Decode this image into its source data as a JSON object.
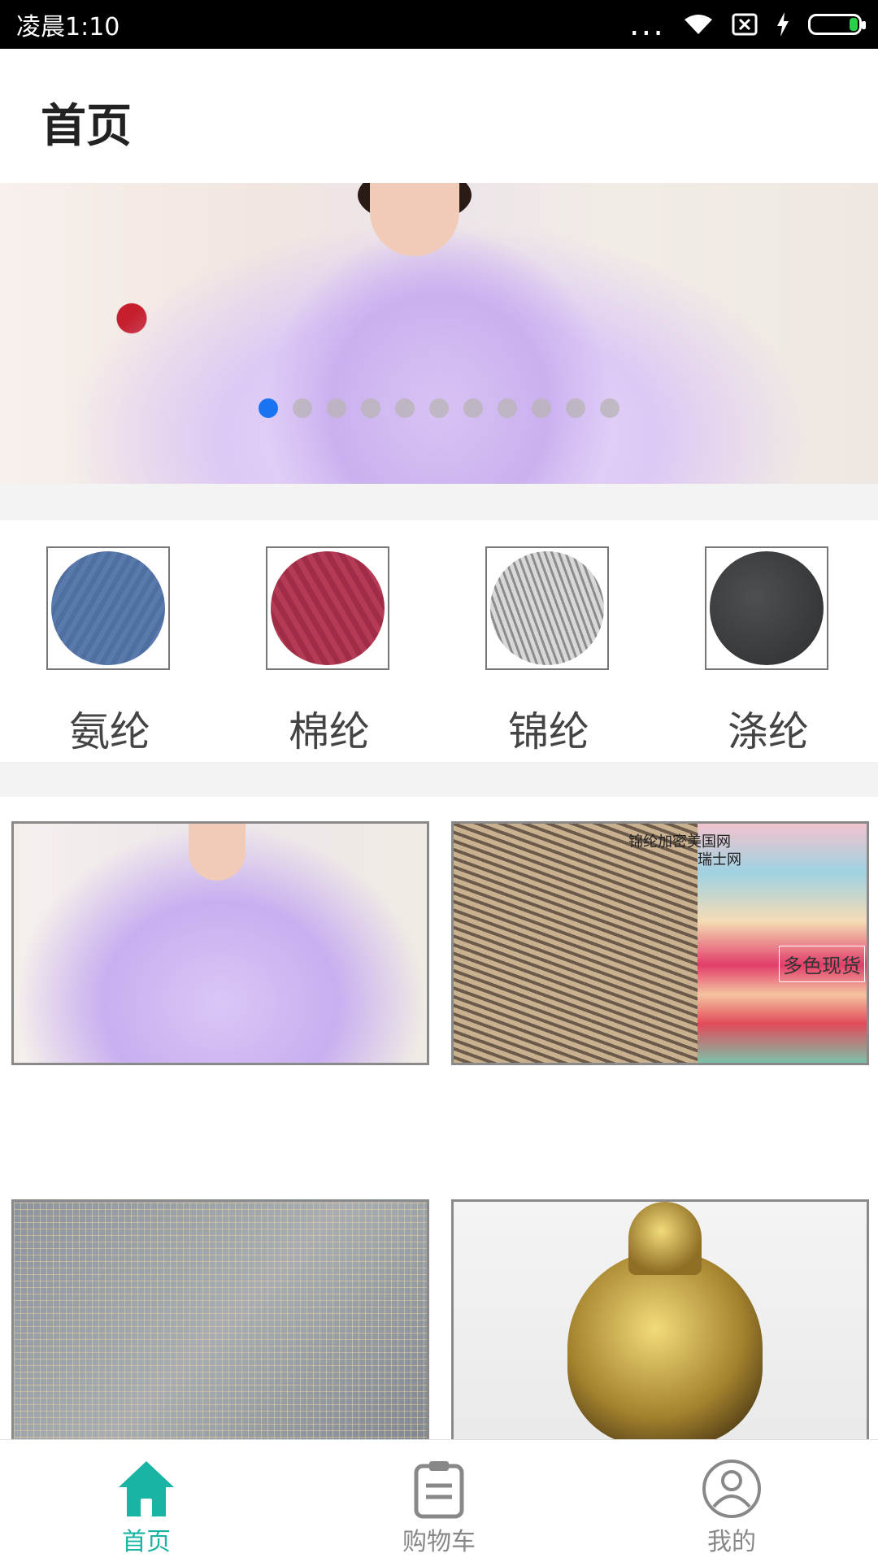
{
  "status_bar": {
    "time": "凌晨1:10",
    "more": "..."
  },
  "header": {
    "title": "首页"
  },
  "banner": {
    "page_count": 11,
    "active_index": 0
  },
  "categories": [
    {
      "label": "氨纶",
      "color": "#4f6fa0"
    },
    {
      "label": "棉纶",
      "color": "#a12c47"
    },
    {
      "label": "锦纶",
      "color": "#8c8c8c"
    },
    {
      "label": "涤纶",
      "color": "#2c2e30"
    }
  ],
  "products": {
    "p2_caption_1": "锦纶加密美国网",
    "p2_caption_2": "瑞士网",
    "p2_stamp": "多色现货"
  },
  "bottom_nav": {
    "home": "首页",
    "cart": "购物车",
    "mine": "我的",
    "active_color": "#19b4a3"
  }
}
